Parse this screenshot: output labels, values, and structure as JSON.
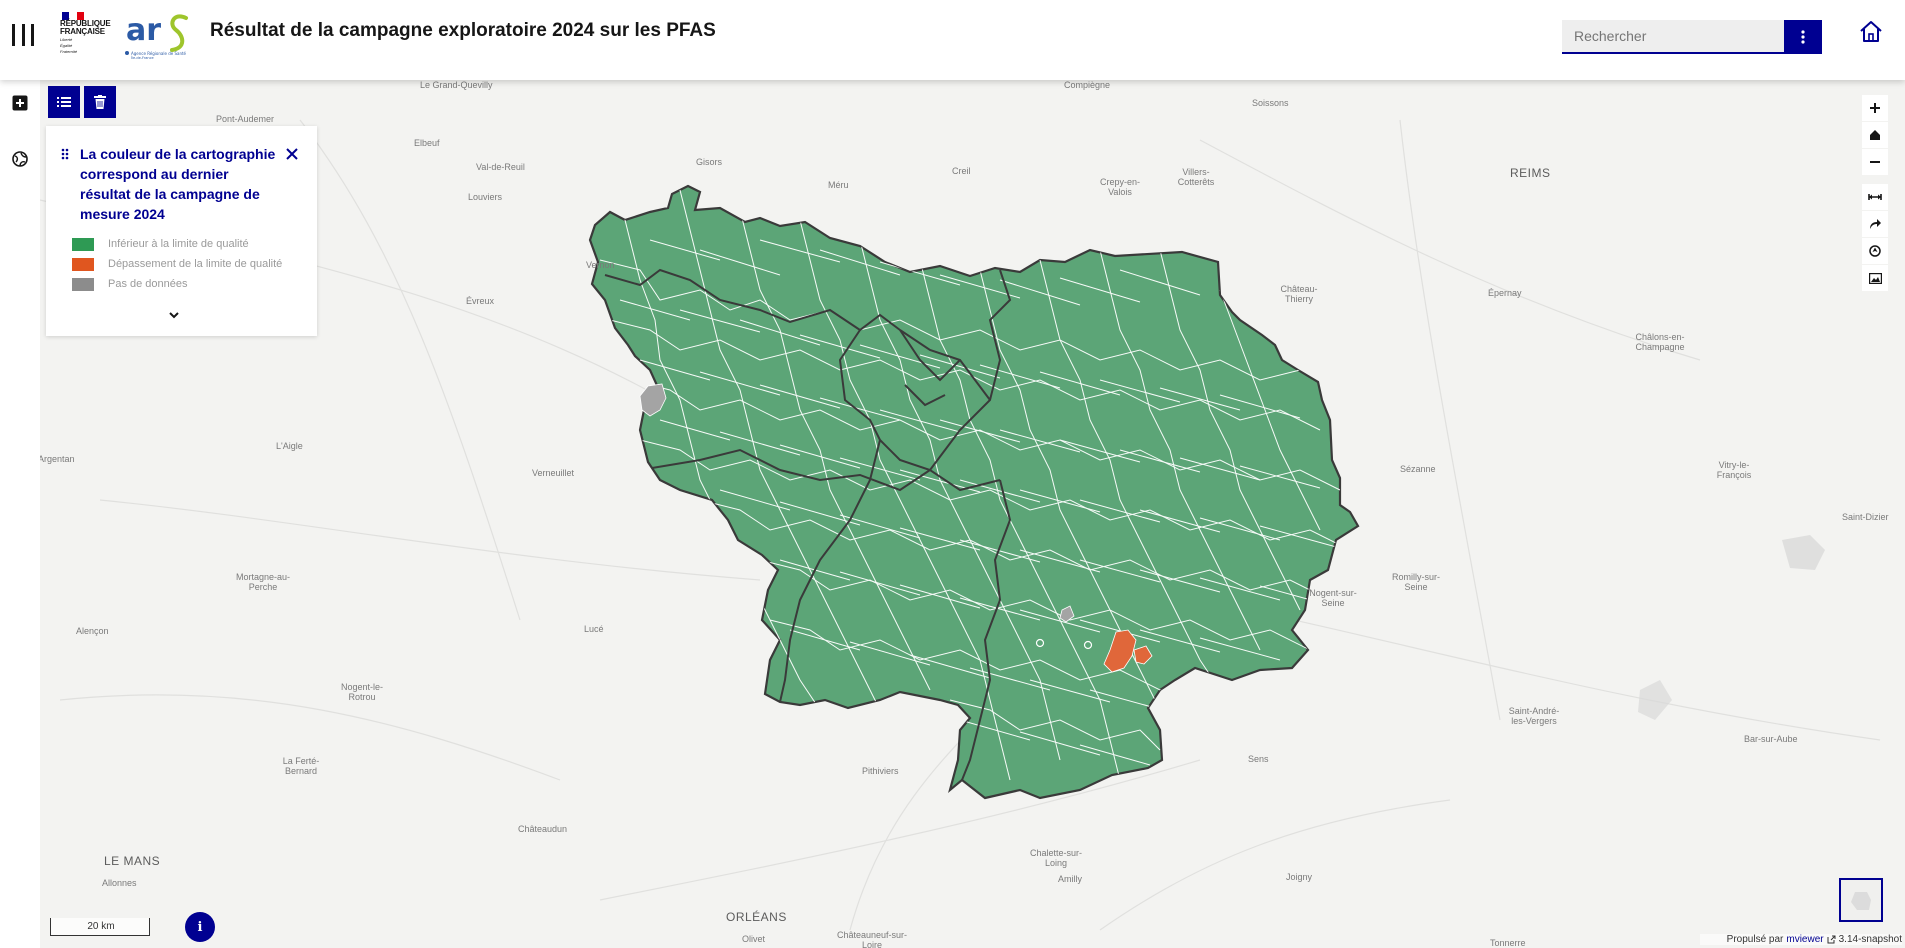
{
  "header": {
    "logo_rf": {
      "line1": "RÉPUBLIQUE",
      "line2": "FRANÇAISE",
      "motto": [
        "Liberté",
        "Égalité",
        "Fraternité"
      ]
    },
    "logo_ars": {
      "text": "ars",
      "subtitle": "Agence Régionale de Santé Île-de-France"
    },
    "title": "Résultat de la campagne exploratoire 2024 sur les PFAS",
    "search_placeholder": "Rechercher",
    "icons": [
      "menu-bars-icon",
      "more-vert-icon",
      "home-icon"
    ]
  },
  "legend": {
    "title": "La couleur de la cartographie correspond au dernier résultat de la campagne de mesure 2024",
    "items": [
      {
        "label": "Inférieur à la limite de qualité",
        "color": "#2e9a54"
      },
      {
        "label": "Dépassement de la limite de qualité",
        "color": "#e0561f"
      },
      {
        "label": "Pas de données",
        "color": "#8c8c8c"
      }
    ]
  },
  "map": {
    "fill_color": "#5ca577",
    "exceed_color": "#e0673a",
    "nodata_color": "#a4a4a4",
    "places": [
      {
        "name": "Le Grand-Quevilly"
      },
      {
        "name": "Compiègne"
      },
      {
        "name": "Pont-Audemer"
      },
      {
        "name": "Soissons"
      },
      {
        "name": "Elbeuf"
      },
      {
        "name": "Val-de-Reuil"
      },
      {
        "name": "Gisors"
      },
      {
        "name": "Louviers"
      },
      {
        "name": "Méru"
      },
      {
        "name": "Creil"
      },
      {
        "name": "Villers-Cotterêts"
      },
      {
        "name": "Crepy-en-Valois"
      },
      {
        "name": "REIMS"
      },
      {
        "name": "Vernon"
      },
      {
        "name": "Évreux"
      },
      {
        "name": "Château-Thierry"
      },
      {
        "name": "Épernay"
      },
      {
        "name": "Châlons-en-Champagne"
      },
      {
        "name": "L'Aigle"
      },
      {
        "name": "Argentan"
      },
      {
        "name": "Verneuillet"
      },
      {
        "name": "Sézanne"
      },
      {
        "name": "Vitry-le-François"
      },
      {
        "name": "Saint-Dizier"
      },
      {
        "name": "Mortagne-au-Perche"
      },
      {
        "name": "Alençon"
      },
      {
        "name": "Lucé"
      },
      {
        "name": "Romilly-sur-Seine"
      },
      {
        "name": "Nogent-sur-Seine"
      },
      {
        "name": "Nogent-le-Rotrou"
      },
      {
        "name": "Saint-André-les-Vergers"
      },
      {
        "name": "Bar-sur-Aube"
      },
      {
        "name": "La Ferté-Bernard"
      },
      {
        "name": "Pithiviers"
      },
      {
        "name": "Sens"
      },
      {
        "name": "Châteaudun"
      },
      {
        "name": "LE MANS"
      },
      {
        "name": "Allonnes"
      },
      {
        "name": "Chalette-sur-Loing"
      },
      {
        "name": "Amilly"
      },
      {
        "name": "Joigny"
      },
      {
        "name": "ORLÉANS"
      },
      {
        "name": "Olivet"
      },
      {
        "name": "Châteauneuf-sur-Loire"
      },
      {
        "name": "Tonnerre"
      }
    ]
  },
  "tools_right": [
    "zoom-in-icon",
    "home-extent-icon",
    "zoom-out-icon",
    "measure-icon",
    "share-icon",
    "location-icon",
    "print-image-icon"
  ],
  "tools_left": [
    "add-layer-icon",
    "globe-icon",
    "legend-list-icon",
    "trash-icon"
  ],
  "footer": {
    "scale": "20 km",
    "info": "i",
    "powered_by": "Propulsé par",
    "powered_link": "mviewer",
    "version": "3.14-snapshot"
  }
}
